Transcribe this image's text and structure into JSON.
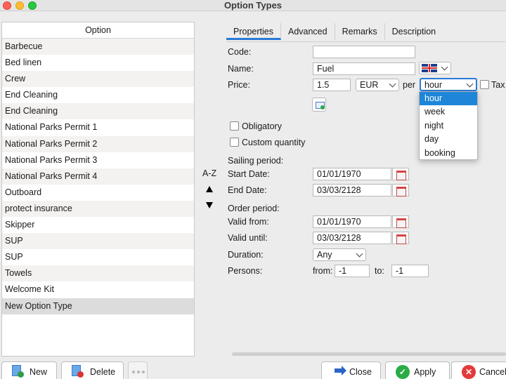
{
  "window": {
    "title": "Option Types"
  },
  "list": {
    "header": "Option",
    "items": [
      "Barbecue",
      "Bed linen",
      "Crew",
      "End Cleaning",
      "End Cleaning",
      "National Parks Permit 1",
      "National Parks Permit 2",
      "National Parks Permit 3",
      "National Parks Permit 4",
      "Outboard",
      "protect insurance",
      "Skipper",
      "SUP",
      "SUP",
      "Towels",
      "Welcome Kit",
      "New Option Type"
    ],
    "selected_index": 16
  },
  "sort": {
    "label": "A-Z"
  },
  "tabs": [
    {
      "label": "Properties",
      "active": true
    },
    {
      "label": "Advanced",
      "active": false
    },
    {
      "label": "Remarks",
      "active": false
    },
    {
      "label": "Description",
      "active": false
    }
  ],
  "form": {
    "code_label": "Code:",
    "code_value": "",
    "name_label": "Name:",
    "name_value": "Fuel",
    "flag_icon": "uk-flag-icon",
    "price_label": "Price:",
    "price_value": "1.5",
    "currency": "EUR",
    "per_label": "per",
    "per_value": "hour",
    "tax_label": "Tax",
    "obligatory_label": "Obligatory",
    "custom_quantity_label": "Custom quantity",
    "sailing_period_label": "Sailing period:",
    "start_date_label": "Start Date:",
    "start_date": "01/01/1970",
    "end_date_label": "End Date:",
    "end_date": "03/03/2128",
    "order_period_label": "Order period:",
    "valid_from_label": "Valid from:",
    "valid_from": "01/01/1970",
    "valid_until_label": "Valid until:",
    "valid_until": "03/03/2128",
    "duration_label": "Duration:",
    "duration_value": "Any",
    "persons_label": "Persons:",
    "from_label": "from:",
    "from_value": "-1",
    "to_label": "to:",
    "to_value": "-1"
  },
  "per_dropdown": {
    "options": [
      "hour",
      "week",
      "night",
      "day",
      "booking"
    ],
    "highlighted_index": 0
  },
  "buttons": {
    "new": "New",
    "delete": "Delete",
    "close": "Close",
    "apply": "Apply",
    "cancel": "Cancel"
  },
  "colors": {
    "accent": "#1e86d9",
    "tab_underline": "#2a7ad6",
    "apply_green": "#2bac46",
    "cancel_red": "#e33a3a"
  }
}
